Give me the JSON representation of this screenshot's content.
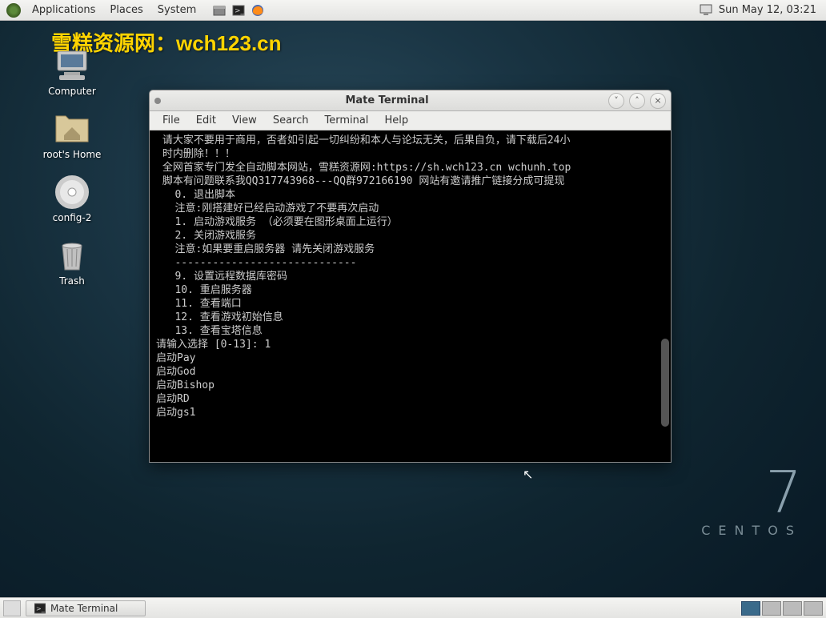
{
  "top_panel": {
    "menus": [
      "Applications",
      "Places",
      "System"
    ],
    "clock": "Sun May 12, 03:21"
  },
  "watermark": "雪糕资源网：wch123.cn",
  "desktop_icons": [
    {
      "name": "computer",
      "label": "Computer"
    },
    {
      "name": "roots-home",
      "label": "root's Home"
    },
    {
      "name": "config-2",
      "label": "config-2"
    },
    {
      "name": "trash",
      "label": "Trash"
    }
  ],
  "terminal": {
    "title": "Mate Terminal",
    "menu": [
      "File",
      "Edit",
      "View",
      "Search",
      "Terminal",
      "Help"
    ],
    "lines": [
      {
        "cls": "green",
        "text": " 请大家不要用于商用，否者如引起一切纠纷和本人与论坛无关，后果自负，请下载后24小"
      },
      {
        "cls": "green",
        "text": " 时内删除！！！"
      },
      {
        "cls": "green",
        "text": " 全网首家专门发全自动脚本网站，雪糕资源网:https://sh.wch123.cn wchunh.top"
      },
      {
        "cls": "green",
        "text": " 脚本有问题联系我QQ317743968---QQ群972166190 网站有邀请推广链接分成可提现"
      },
      {
        "cls": "white",
        "text": ""
      },
      {
        "cls": "white",
        "text": "   0. 退出脚本"
      },
      {
        "cls": "green",
        "text": "   注意:刚搭建好已经启动游戏了不要再次启动"
      },
      {
        "cls": "white",
        "text": "   1. 启动游戏服务 （必须要在图形桌面上运行）"
      },
      {
        "cls": "white",
        "text": "   2. 关闭游戏服务"
      },
      {
        "cls": "green",
        "text": "   注意:如果要重启服务器 请先关闭游戏服务"
      },
      {
        "cls": "white",
        "text": "   -----------------------------"
      },
      {
        "cls": "white",
        "text": "   9. 设置远程数据库密码"
      },
      {
        "cls": "white",
        "text": "   10. 重启服务器"
      },
      {
        "cls": "white",
        "text": "   11. 查看端口"
      },
      {
        "cls": "white",
        "text": "   12. 查看游戏初始信息"
      },
      {
        "cls": "white",
        "text": "   13. 查看宝塔信息"
      },
      {
        "cls": "white",
        "text": ""
      },
      {
        "cls": "white",
        "text": "请输入选择 [0-13]: 1"
      },
      {
        "cls": "white",
        "text": "启动Pay"
      },
      {
        "cls": "white",
        "text": "启动God"
      },
      {
        "cls": "white",
        "text": "启动Bishop"
      },
      {
        "cls": "white",
        "text": "启动RD"
      },
      {
        "cls": "white",
        "text": "启动gs1"
      }
    ]
  },
  "brand": {
    "seven": "7",
    "name": "CENTOS"
  },
  "bottom_panel": {
    "task": "Mate Terminal"
  }
}
